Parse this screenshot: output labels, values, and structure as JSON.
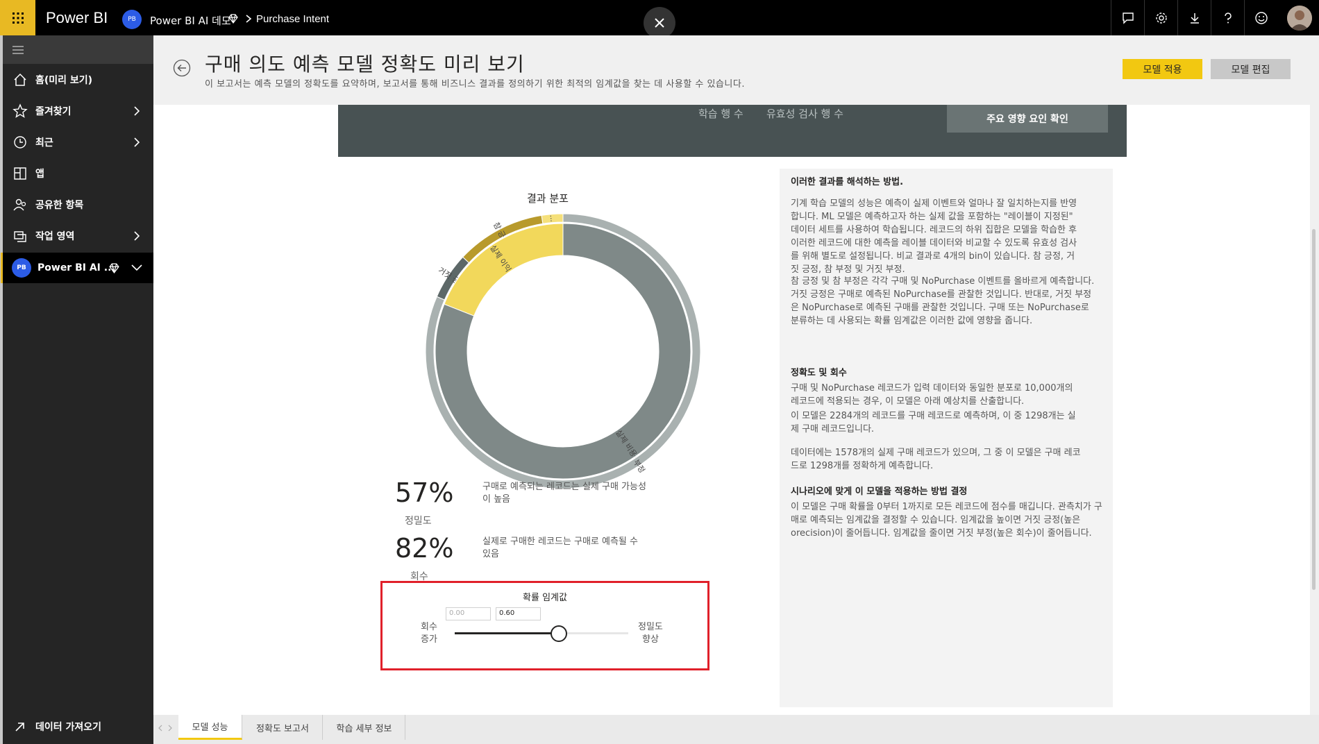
{
  "app": {
    "brand": "Power BI",
    "workspace_initials": "PB",
    "workspace_name": "Power BI AI 데모",
    "report_name": "Purchase Intent"
  },
  "sidebar": {
    "items": [
      {
        "label": "홈(미리 보기)",
        "icon": "home-icon"
      },
      {
        "label": "즐겨찾기",
        "icon": "star-icon"
      },
      {
        "label": "최근",
        "icon": "clock-icon"
      },
      {
        "label": "앱",
        "icon": "apps-icon"
      },
      {
        "label": "공유한 항목",
        "icon": "shared-icon"
      },
      {
        "label": "작업 영역",
        "icon": "workspaces-icon"
      }
    ],
    "workspace": {
      "initials": "PB",
      "label": "Power BI AI ..."
    },
    "get_data": "데이터 가져오기"
  },
  "header": {
    "title": "구매 의도 예측 모델 정확도 미리 보기",
    "subtitle": "이 보고서는 예측 모델의 정확도를 요약하며, 보고서를 통해 비즈니스 결과를 정의하기 위한 최적의 임계값을 찾는 데 사용할 수 있습니다.",
    "apply_button": "모델 적용",
    "edit_button": "모델 편집"
  },
  "band": {
    "training_rows": "학습 행 수",
    "validation_rows": "유효성 검사 행 수",
    "top_factors_button": "주요 영향 요인 확인"
  },
  "chart_data": {
    "type": "pie",
    "title": "결과 분포",
    "outer_ring": [
      {
        "label": "...",
        "value": 2.5,
        "color": "#f5e07a"
      },
      {
        "label": "참 긍정",
        "value": 10.5,
        "color": "#b89a2c"
      },
      {
        "label": "거짓 긍정",
        "value": 5.5,
        "color": "#5d6868"
      },
      {
        "label": "참 부정",
        "value": 81.5,
        "color": "#a9b1b0"
      }
    ],
    "inner_ring": [
      {
        "label": "실제 이익",
        "value": 19,
        "color": "#f2d85b"
      },
      {
        "label": "실제 비용",
        "value": 81,
        "color": "#7f8988"
      }
    ]
  },
  "kpis": [
    {
      "value": "57%",
      "label": "정밀도",
      "desc": "구매로 예측되는 레코드는 실제 구매 가능성이 높음"
    },
    {
      "value": "82%",
      "label": "회수",
      "desc": "실제로 구매한 레코드는 구매로 예측될 수 있음"
    }
  ],
  "threshold": {
    "title": "확률 임계값",
    "min_value": "0.00",
    "max_value": "0.60",
    "left_label_1": "회수",
    "left_label_2": "증가",
    "right_label_1": "정밀도",
    "right_label_2": "향상",
    "fraction": 0.6
  },
  "panel": {
    "heading1": "이러한 결과를 해석하는 방법.",
    "p1": "기계 학습 모델의 성능은 예측이 실제 이벤트와 얼마나 잘 일치하는지를 반영합니다.  ML 모델은 예측하고자 하는 실제 값을 포함하는 \"레이블이 지정된\" 데이터 세트를 사용하여 학습됩니다.  레코드의 하위 집합은 모델을 학습한 후 이러한 레코드에 대한 예측을 레이블 데이터와 비교할 수 있도록 유효성 검사를 위해 별도로 설정됩니다.  비교 결과로 4개의 bin이 있습니다.  참 긍정, 거짓 긍정, 참 부정 및 거짓 부정.",
    "p2": "참 긍정 및 참 부정은 각각 구매 및 NoPurchase 이벤트를 올바르게 예측합니다.  거짓 긍정은 구매로 예측된 NoPurchase를 관찰한 것입니다.  반대로, 거짓 부정은 NoPurchase로 예측된 구매를 관찰한 것입니다.  구매 또는 NoPurchase로 분류하는 데 사용되는 확률 임계값은 이러한 값에 영향을 줍니다.",
    "heading2": "정확도 및 회수",
    "p3": "구매 및 NoPurchase 레코드가 입력 데이터와 동일한 분포로 10,000개의 레코드에 적용되는 경우, 이 모델은 아래 예상치를 산출합니다.",
    "p4": "이 모델은 2284개의 레코드를 구매 레코드로 예측하며, 이 중 1298개는 실제 구매 레코드입니다.",
    "p5": "데이터에는 1578개의 실제 구매 레코드가 있으며, 그 중 이 모델은 구매 레코드로 1298개를 정확하게 예측합니다.",
    "heading3": "시나리오에 맞게 이 모델을 적용하는 방법 결정",
    "p6": "이 모델은 구매 확률을 0부터 1까지로 모든 레코드에 점수를 매깁니다.  관측치가 구매로 예측되는 임계값을 결정할 수 있습니다. 임계값을 높이면 거짓 긍정(높은 orecision)이 줄어듭니다. 임계값을 줄이면 거짓 부정(높은 회수)이 줄어듭니다."
  },
  "tabs": [
    "모델 성능",
    "정확도 보고서",
    "학습 세부 정보"
  ]
}
